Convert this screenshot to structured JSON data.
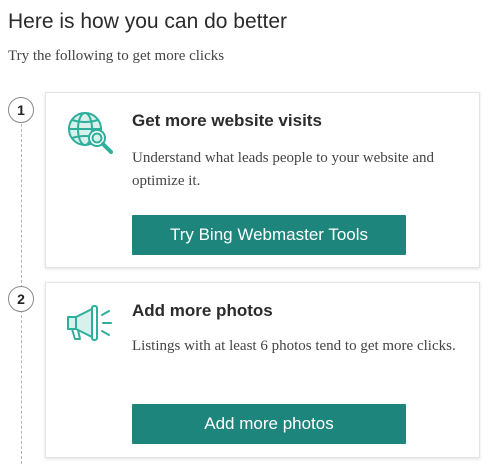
{
  "header": {
    "title": "Here is how you can do better",
    "subtitle": "Try the following to get more clicks"
  },
  "steps": [
    {
      "number": "1",
      "icon": "globe-search-icon",
      "title": "Get more website visits",
      "description": "Understand what leads people to your website and optimize it.",
      "button_label": "Try Bing Webmaster Tools"
    },
    {
      "number": "2",
      "icon": "megaphone-icon",
      "title": "Add more photos",
      "description": "Listings with at least 6 photos tend to get more clicks.",
      "button_label": "Add more photos"
    }
  ],
  "colors": {
    "accent": "#1e857d",
    "icon": "#2fae9c"
  }
}
